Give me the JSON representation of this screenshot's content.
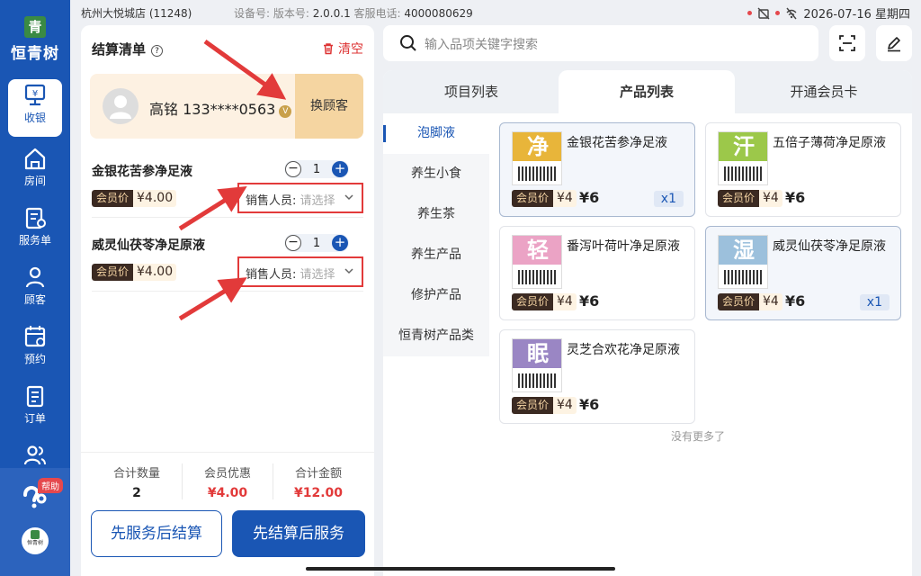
{
  "sidebar": {
    "logo_mark": "青",
    "logo_text": "恒青树",
    "items": [
      {
        "label": "收银",
        "icon": "cashier-icon"
      },
      {
        "label": "房间",
        "icon": "house-icon"
      },
      {
        "label": "服务单",
        "icon": "service-order-icon"
      },
      {
        "label": "顾客",
        "icon": "person-icon"
      },
      {
        "label": "预约",
        "icon": "calendar-icon"
      },
      {
        "label": "订单",
        "icon": "order-list-icon"
      }
    ],
    "help_badge": "帮助",
    "avatar_text": "恒青树"
  },
  "topbar": {
    "store": "杭州大悦城店  (11248)",
    "device_label": "设备号: 版本号: ",
    "version": "2.0.0.1",
    "phone_label": " 客服电话: ",
    "phone": "4000080629",
    "datetime": "2026-07-16 星期四"
  },
  "cart": {
    "title": "结算清单",
    "clear_label": "清空",
    "customer": {
      "name": "高铭 133****0563",
      "vip_mark": "V",
      "switch_label": "换顾客"
    },
    "items": [
      {
        "name": "金银花苦参净足液",
        "qty": "1",
        "member_label": "会员价",
        "member_price": "¥4.00",
        "seller_label": "销售人员:",
        "seller_placeholder": "请选择"
      },
      {
        "name": "威灵仙茯苓净足原液",
        "qty": "1",
        "member_label": "会员价",
        "member_price": "¥4.00",
        "seller_label": "销售人员:",
        "seller_placeholder": "请选择"
      }
    ],
    "summary": {
      "count_label": "合计数量",
      "count": "2",
      "discount_label": "会员优惠",
      "discount": "¥4.00",
      "total_label": "合计金额",
      "total": "¥12.00"
    },
    "btn_service_first": "先服务后结算",
    "btn_pay_first": "先结算后服务"
  },
  "search": {
    "placeholder": "输入品项关键字搜索"
  },
  "tabs": [
    "项目列表",
    "产品列表",
    "开通会员卡"
  ],
  "categories": [
    "泡脚液",
    "养生小食",
    "养生茶",
    "养生产品",
    "修护产品",
    "恒青树产品类"
  ],
  "products": [
    {
      "name": "金银花苦参净足液",
      "glyph": "净",
      "color": "#e8b53a",
      "member_label": "会员价",
      "member_price": "¥4",
      "price": "¥6",
      "qty": "x1"
    },
    {
      "name": "五倍子薄荷净足原液",
      "glyph": "汗",
      "color": "#9cc84a",
      "member_label": "会员价",
      "member_price": "¥4",
      "price": "¥6",
      "qty": ""
    },
    {
      "name": "番泻叶荷叶净足原液",
      "glyph": "轻",
      "color": "#eba3c5",
      "member_label": "会员价",
      "member_price": "¥4",
      "price": "¥6",
      "qty": ""
    },
    {
      "name": "威灵仙茯苓净足原液",
      "glyph": "湿",
      "color": "#9cc0dc",
      "member_label": "会员价",
      "member_price": "¥4",
      "price": "¥6",
      "qty": "x1"
    },
    {
      "name": "灵芝合欢花净足原液",
      "glyph": "眠",
      "color": "#9a86c4",
      "member_label": "会员价",
      "member_price": "¥4",
      "price": "¥6",
      "qty": ""
    }
  ],
  "no_more": "没有更多了",
  "colors": {
    "primary": "#1a56b4",
    "danger": "#e23a3a",
    "member_dark": "#3b2a22",
    "customer_bg": "#fdf1e2"
  }
}
